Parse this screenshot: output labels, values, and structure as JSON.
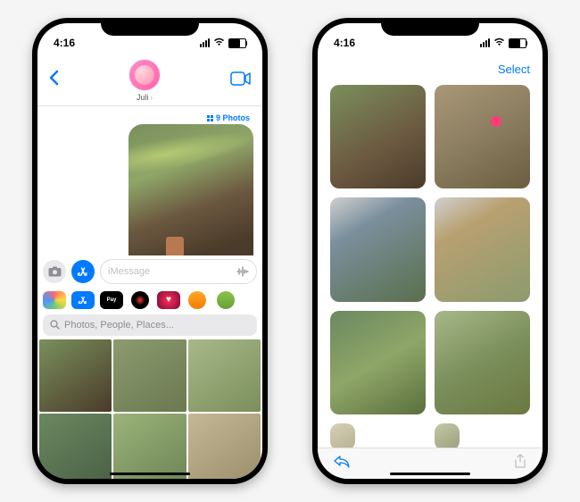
{
  "status": {
    "time": "4:16",
    "wifi": "􀙇"
  },
  "left": {
    "contact_name": "Juli",
    "photos_count": "9 Photos",
    "input_placeholder": "iMessage",
    "search_placeholder": "Photos, People, Places...",
    "apple_pay_label": "Pay",
    "app_icons": [
      "photos",
      "appstore",
      "applepay",
      "fitness",
      "heart",
      "memoji1",
      "memoji2"
    ]
  },
  "right": {
    "select_label": "Select"
  }
}
